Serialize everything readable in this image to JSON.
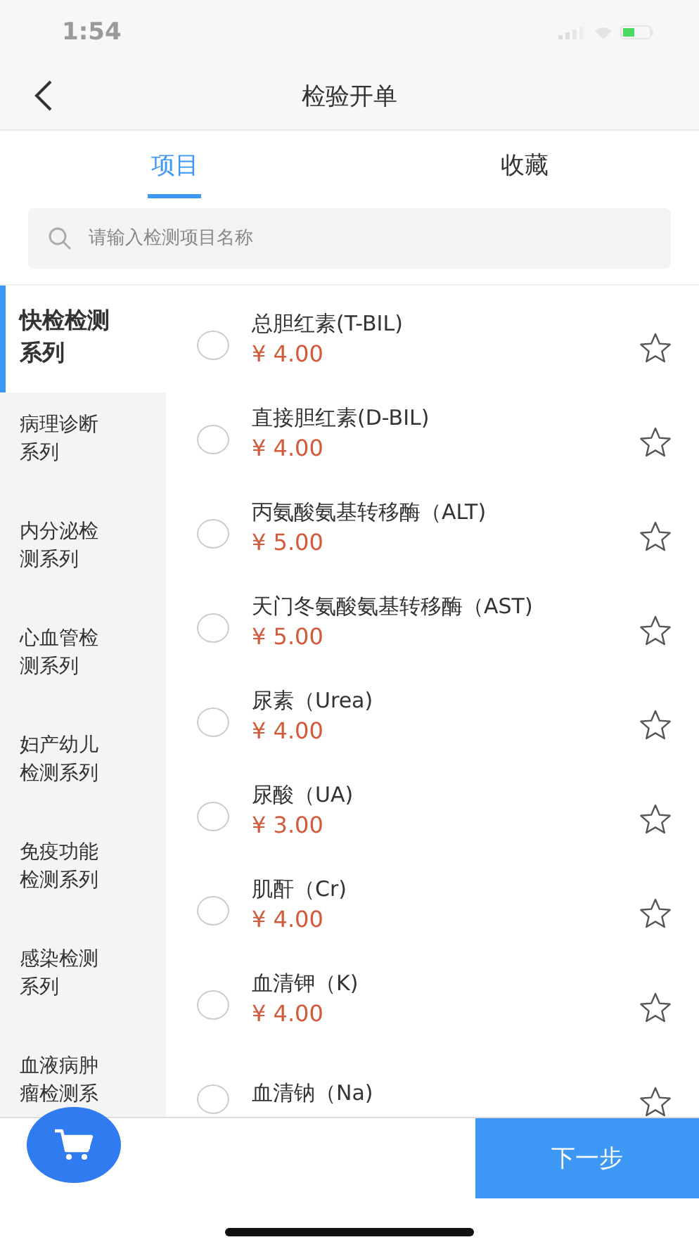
{
  "status_bar": {
    "time": "1:54"
  },
  "header": {
    "title": "检验开单"
  },
  "tabs": [
    {
      "label": "项目",
      "selected": true
    },
    {
      "label": "收藏",
      "selected": false
    }
  ],
  "search": {
    "placeholder": "请输入检测项目名称"
  },
  "categories": [
    {
      "label": "快检检测系列",
      "selected": true
    },
    {
      "label": "病理诊断系列",
      "selected": false
    },
    {
      "label": "内分泌检测系列",
      "selected": false
    },
    {
      "label": "心血管检测系列",
      "selected": false
    },
    {
      "label": "妇产幼儿检测系列",
      "selected": false
    },
    {
      "label": "免疫功能检测系列",
      "selected": false
    },
    {
      "label": "感染检测系列",
      "selected": false
    },
    {
      "label": "血液病肿瘤检测系",
      "selected": false
    }
  ],
  "items": [
    {
      "name": "总胆红素(T-BIL)",
      "price": "¥ 4.00",
      "checked": false,
      "favorite": false
    },
    {
      "name": "直接胆红素(D-BIL)",
      "price": "¥ 4.00",
      "checked": false,
      "favorite": false
    },
    {
      "name": "丙氨酸氨基转移酶（ALT)",
      "price": "¥ 5.00",
      "checked": false,
      "favorite": false
    },
    {
      "name": "天门冬氨酸氨基转移酶（AST)",
      "price": "¥ 5.00",
      "checked": false,
      "favorite": false
    },
    {
      "name": "尿素（Urea)",
      "price": "¥ 4.00",
      "checked": false,
      "favorite": false
    },
    {
      "name": "尿酸（UA)",
      "price": "¥ 3.00",
      "checked": false,
      "favorite": false
    },
    {
      "name": "肌酐（Cr)",
      "price": "¥ 4.00",
      "checked": false,
      "favorite": false
    },
    {
      "name": "血清钾（K)",
      "price": "¥ 4.00",
      "checked": false,
      "favorite": false
    },
    {
      "name": "血清钠（Na)",
      "checked": false,
      "favorite": false
    }
  ],
  "footer": {
    "next_button": "下一步"
  }
}
